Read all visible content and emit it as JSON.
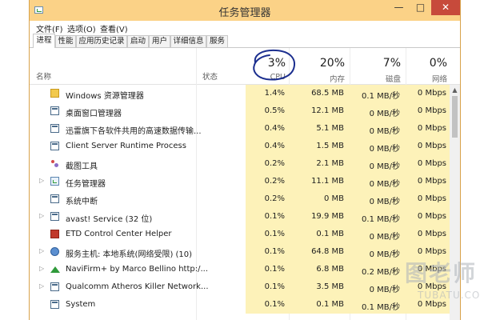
{
  "window": {
    "title": "任务管理器",
    "controls": {
      "minimize": "—",
      "maximize": "□",
      "close": "✕"
    },
    "accent_color": "#fbd287"
  },
  "menu": [
    "文件(F)",
    "选项(O)",
    "查看(V)"
  ],
  "tabs": [
    {
      "label": "进程",
      "active": true
    },
    {
      "label": "性能",
      "active": false
    },
    {
      "label": "应用历史记录",
      "active": false
    },
    {
      "label": "启动",
      "active": false
    },
    {
      "label": "用户",
      "active": false
    },
    {
      "label": "详细信息",
      "active": false
    },
    {
      "label": "服务",
      "active": false
    }
  ],
  "columns": {
    "name": "名称",
    "status": "状态",
    "cpu": {
      "pct": "3%",
      "label": "CPU"
    },
    "memory": {
      "pct": "20%",
      "label": "内存"
    },
    "disk": {
      "pct": "7%",
      "label": "磁盘"
    },
    "network": {
      "pct": "0%",
      "label": "网络"
    }
  },
  "rows": [
    {
      "name": "Windows 资源管理器",
      "icon": "folder-icon",
      "expandable": false,
      "cpu": "1.4%",
      "memory": "68.5 MB",
      "disk": "0.1 MB/秒",
      "network": "0 Mbps"
    },
    {
      "name": "桌面窗口管理器",
      "icon": "window-icon",
      "expandable": false,
      "cpu": "0.5%",
      "memory": "12.1 MB",
      "disk": "0 MB/秒",
      "network": "0 Mbps"
    },
    {
      "name": "迅雷旗下各软件共用的高速数据传输...",
      "icon": "window-icon",
      "expandable": false,
      "cpu": "0.4%",
      "memory": "5.1 MB",
      "disk": "0 MB/秒",
      "network": "0 Mbps"
    },
    {
      "name": "Client Server Runtime Process",
      "icon": "window-icon",
      "expandable": false,
      "cpu": "0.4%",
      "memory": "1.5 MB",
      "disk": "0 MB/秒",
      "network": "0 Mbps"
    },
    {
      "name": "截图工具",
      "icon": "snipping-tool-icon",
      "expandable": false,
      "cpu": "0.2%",
      "memory": "2.1 MB",
      "disk": "0 MB/秒",
      "network": "0 Mbps"
    },
    {
      "name": "任务管理器",
      "icon": "task-manager-icon",
      "expandable": true,
      "cpu": "0.2%",
      "memory": "11.1 MB",
      "disk": "0 MB/秒",
      "network": "0 Mbps"
    },
    {
      "name": "系统中断",
      "icon": "window-icon",
      "expandable": false,
      "cpu": "0.2%",
      "memory": "0 MB",
      "disk": "0 MB/秒",
      "network": "0 Mbps"
    },
    {
      "name": "avast! Service (32 位)",
      "icon": "window-icon",
      "expandable": true,
      "cpu": "0.1%",
      "memory": "19.9 MB",
      "disk": "0.1 MB/秒",
      "network": "0 Mbps"
    },
    {
      "name": "ETD Control Center Helper",
      "icon": "etd-icon",
      "expandable": false,
      "cpu": "0.1%",
      "memory": "0.1 MB",
      "disk": "0 MB/秒",
      "network": "0 Mbps"
    },
    {
      "name": "服务主机: 本地系统(网络受限) (10)",
      "icon": "gear-icon",
      "expandable": true,
      "cpu": "0.1%",
      "memory": "64.8 MB",
      "disk": "0 MB/秒",
      "network": "0 Mbps"
    },
    {
      "name": "NaviFirm+ by Marco Bellino http:/...",
      "icon": "navi-icon",
      "expandable": true,
      "cpu": "0.1%",
      "memory": "6.8 MB",
      "disk": "0.2 MB/秒",
      "network": "0 Mbps"
    },
    {
      "name": "Qualcomm Atheros Killer Network...",
      "icon": "window-icon",
      "expandable": true,
      "cpu": "0.1%",
      "memory": "3.5 MB",
      "disk": "0 MB/秒",
      "network": "0 Mbps"
    },
    {
      "name": "System",
      "icon": "window-icon",
      "expandable": false,
      "cpu": "0.1%",
      "memory": "0.1 MB",
      "disk": "0.1 MB/秒",
      "network": "0 Mbps"
    }
  ],
  "watermark": {
    "big": "图老师",
    "small": "TUBATU.COM"
  }
}
